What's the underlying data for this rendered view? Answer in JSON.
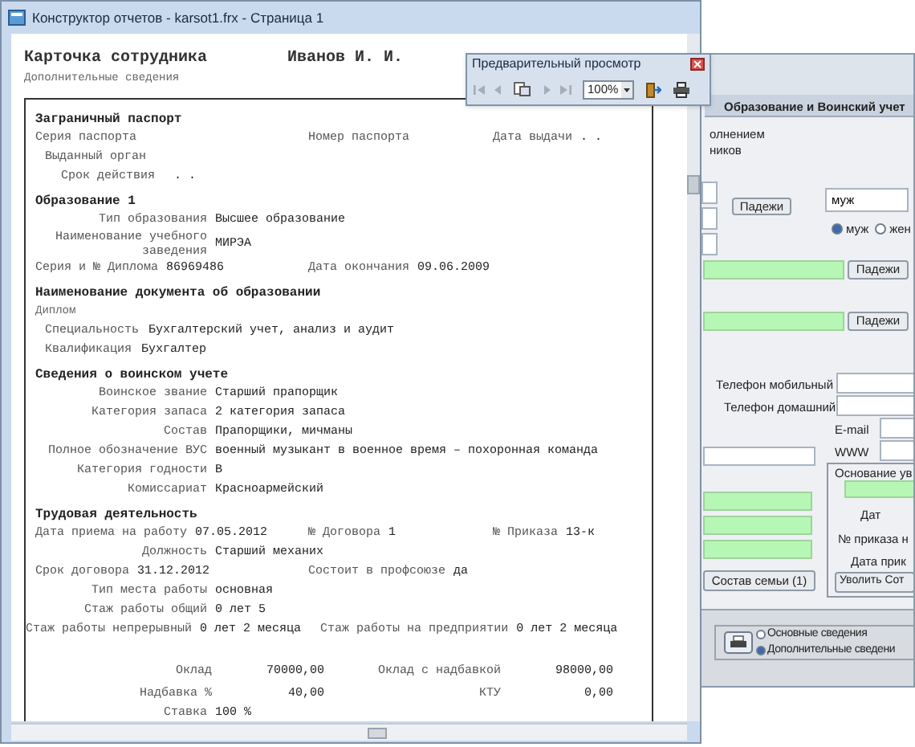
{
  "report_window": {
    "title": "Конструктор отчетов - karsot1.frx - Страница 1",
    "report": {
      "title": "Карточка сотрудника",
      "employee": "Иванов И. И.",
      "subtitle": "Дополнительные сведения",
      "lines": [
        {
          "kind": "heading",
          "text": "Заграничный паспорт"
        },
        {
          "kind": "row",
          "cells": [
            {
              "label": "Серия паспорта"
            },
            {
              "label": "Номер паспорта"
            },
            {
              "label": "Дата выдачи",
              "value": ".  ."
            }
          ]
        },
        {
          "kind": "indent",
          "label": "Выданный орган"
        },
        {
          "kind": "indent2",
          "label": "Срок действия",
          "value": ".  ."
        },
        {
          "kind": "heading",
          "text": "Образование 1"
        },
        {
          "kind": "aligned",
          "label": "Тип образования",
          "value": "Высшее образование"
        },
        {
          "kind": "aligned",
          "label": "Наименование учебного заведения",
          "value": "МИРЭА"
        },
        {
          "kind": "row",
          "cells": [
            {
              "label": "Серия и № Диплома",
              "value": "86969486"
            },
            {
              "label": "Дата окончания",
              "value": "09.06.2009"
            }
          ]
        },
        {
          "kind": "heading",
          "text": "Наименование документа об образовании"
        },
        {
          "kind": "text",
          "text": "Диплом"
        },
        {
          "kind": "indent",
          "label": "Специальность",
          "value": "Бухгалтерский учет, анализ и аудит"
        },
        {
          "kind": "indent",
          "label": "Квалификация",
          "value": "Бухгалтер"
        },
        {
          "kind": "heading",
          "text": "Сведения о воинском учете"
        },
        {
          "kind": "aligned",
          "label": "Воинское звание",
          "value": "Старший прапорщик"
        },
        {
          "kind": "aligned",
          "label": "Категория запаса",
          "value": "2 категория запаса"
        },
        {
          "kind": "aligned",
          "label": "Состав",
          "value": "Прапорщики, мичманы"
        },
        {
          "kind": "aligned",
          "label": "Полное обозначение ВУС",
          "value": "военный музыкант в военное время – похоронная команда"
        },
        {
          "kind": "aligned",
          "label": "Категория годности",
          "value": "В"
        },
        {
          "kind": "aligned",
          "label": "Комиссариат",
          "value": "Красноармейский"
        },
        {
          "kind": "heading",
          "text": "Трудовая деятельность"
        },
        {
          "kind": "row",
          "cells": [
            {
              "label": "Дата приема на работу",
              "value": "07.05.2012"
            },
            {
              "label": "№ Договора",
              "value": "1"
            },
            {
              "label": "№ Приказа",
              "value": "13-к"
            }
          ]
        },
        {
          "kind": "aligned",
          "label": "Должность",
          "value": "Старший механих"
        },
        {
          "kind": "row",
          "cells": [
            {
              "label": "Срок договора",
              "value": "31.12.2012"
            },
            {
              "label": "Состоит в профсоюзе",
              "value": "да"
            }
          ]
        },
        {
          "kind": "aligned",
          "label": "Тип места работы",
          "value": "основная"
        },
        {
          "kind": "aligned",
          "label": "Стаж работы общий",
          "value": "0 лет 5"
        },
        {
          "kind": "flow",
          "cells": [
            {
              "label": "Стаж работы непрерывный",
              "value": "0 лет 2 месяца"
            },
            {
              "label": "Стаж работы на предприятии",
              "value": "0 лет 2 месяца"
            }
          ]
        },
        {
          "kind": "money",
          "cells": [
            {
              "label": "Оклад",
              "value": "70000,00"
            },
            {
              "label": "Оклад с надбавкой",
              "value": "98000,00"
            }
          ]
        },
        {
          "kind": "money",
          "cells": [
            {
              "label": "Надбавка %",
              "value": "40,00"
            },
            {
              "label": "КТУ",
              "value": "0,00"
            }
          ]
        },
        {
          "kind": "aligned",
          "label": "Ставка",
          "value": "100 %"
        }
      ]
    }
  },
  "preview_toolbar": {
    "title": "Предварительный просмотр",
    "zoom": "100%"
  },
  "form_window": {
    "tab": "Образование и Воинский учет",
    "note_lines": [
      "олнением",
      "ников"
    ],
    "case_buttons": [
      "Падежи",
      "Падежи",
      "Падежи"
    ],
    "gender_field": "муж",
    "gender_options": [
      {
        "label": "муж",
        "selected": true
      },
      {
        "label": "жен",
        "selected": false
      }
    ],
    "contacts": [
      "Телефон мобильный",
      "Телефон домашний",
      "E-mail",
      "WWW"
    ],
    "dismissal": {
      "title": "Основание ув",
      "labels": [
        "Дат",
        "№ приказа н",
        "Дата прик"
      ],
      "button": "Уволить Сот"
    },
    "family_button": "Состав семьи (1)",
    "report_options": [
      {
        "label": "Основные сведения",
        "selected": false
      },
      {
        "label": "Дополнительные сведени",
        "selected": true
      }
    ]
  }
}
